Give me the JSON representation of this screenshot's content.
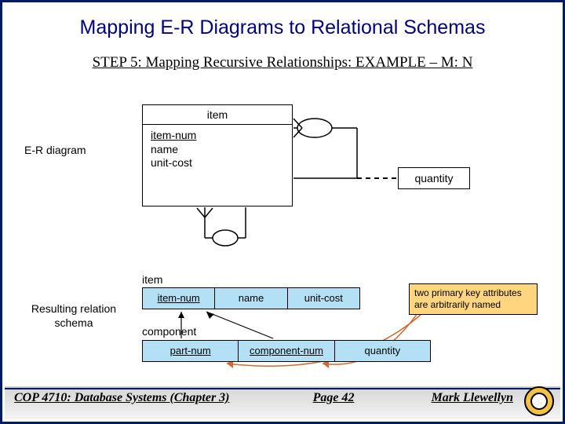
{
  "title": "Mapping E-R Diagrams to Relational Schemas",
  "subtitle": "STEP 5:  Mapping Recursive Relationships: EXAMPLE – M: N",
  "er": {
    "diagram_label": "E-R diagram",
    "entity_name": "item",
    "attrs": {
      "pk": "item-num",
      "a2": "name",
      "a3": "unit-cost"
    },
    "rel_attr": "quantity"
  },
  "schema": {
    "label": "Resulting relation schema",
    "item_label": "item",
    "item_cols": {
      "c1": "item-num",
      "c2": "name",
      "c3": "unit-cost"
    },
    "component_label": "component",
    "component_cols": {
      "c1": "part-num",
      "c2": "component-num",
      "c3": "quantity"
    },
    "note": "two primary key attributes are arbitrarily named"
  },
  "footer": {
    "left": "COP 4710: Database Systems  (Chapter 3)",
    "center": "Page 42",
    "right": "Mark Llewellyn"
  }
}
